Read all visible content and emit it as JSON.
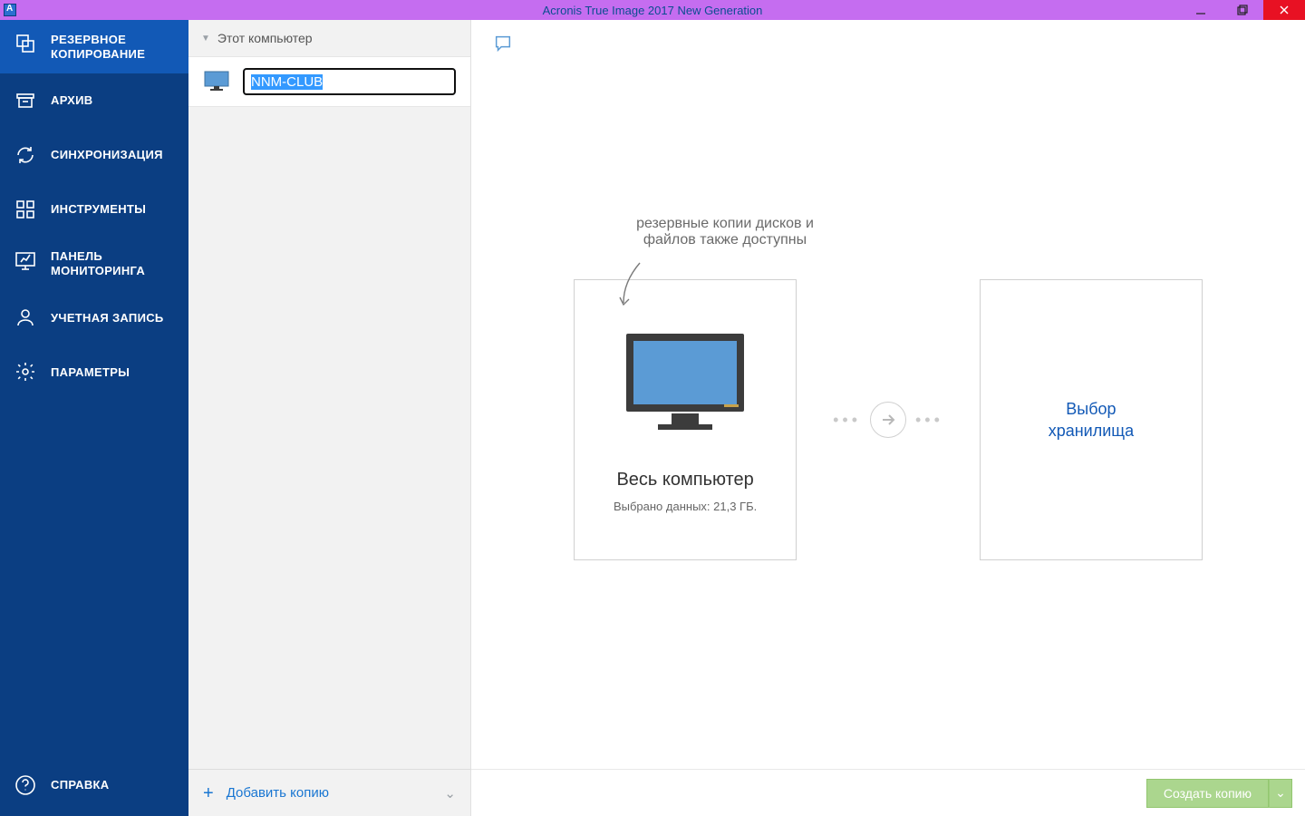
{
  "window": {
    "title": "Acronis True Image 2017 New Generation"
  },
  "nav": {
    "items": [
      {
        "label": "РЕЗЕРВНОЕ КОПИРОВАНИЕ",
        "key": "backup"
      },
      {
        "label": "АРХИВ",
        "key": "archive"
      },
      {
        "label": "СИНХРОНИЗАЦИЯ",
        "key": "sync"
      },
      {
        "label": "ИНСТРУМЕНТЫ",
        "key": "tools"
      },
      {
        "label": "ПАНЕЛЬ МОНИТОРИНГА",
        "key": "dashboard"
      },
      {
        "label": "УЧЕТНАЯ ЗАПИСЬ",
        "key": "account"
      },
      {
        "label": "ПАРАМЕТРЫ",
        "key": "settings"
      }
    ],
    "help": "СПРАВКА"
  },
  "list": {
    "header": "Этот компьютер",
    "item_name": "NNM-CLUB",
    "add_label": "Добавить копию"
  },
  "content": {
    "hint_line1": "резервные копии дисков и",
    "hint_line2": "файлов также доступны",
    "source_title": "Весь компьютер",
    "source_sub": "Выбрано данных: 21,3 ГБ.",
    "dest_line1": "Выбор",
    "dest_line2": "хранилища"
  },
  "footer": {
    "create": "Создать копию"
  }
}
